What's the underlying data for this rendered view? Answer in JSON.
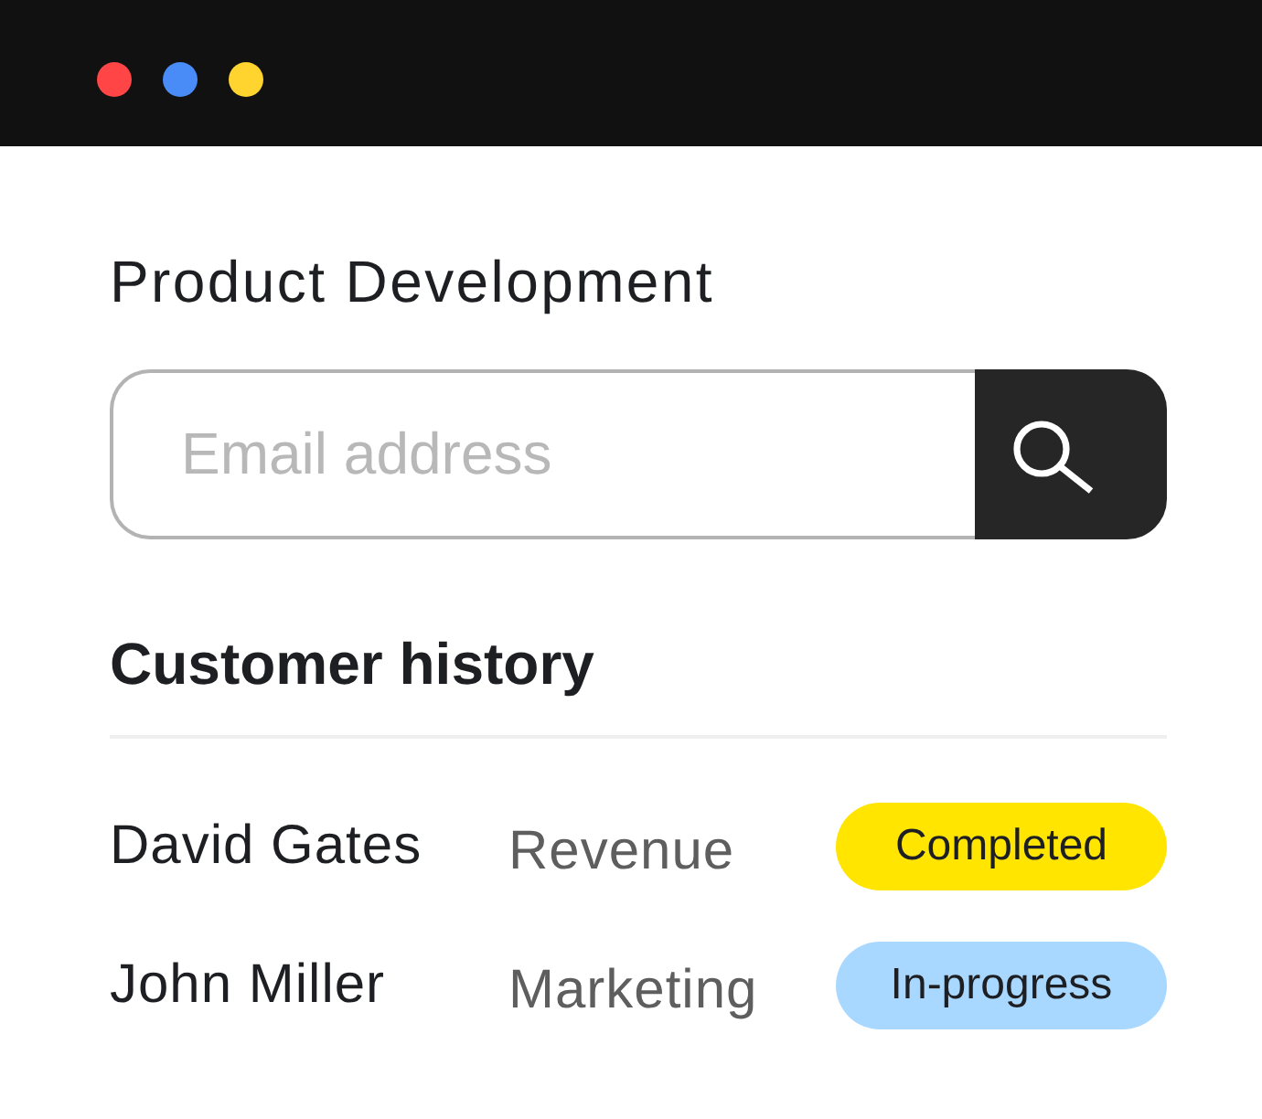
{
  "window": {
    "controls": [
      {
        "color": "#ff4545"
      },
      {
        "color": "#4a8cf7"
      },
      {
        "color": "#ffd42e"
      }
    ]
  },
  "title": "Product Development",
  "search": {
    "placeholder": "Email address"
  },
  "section": {
    "title": "Customer history"
  },
  "rows": [
    {
      "column_1": "David Gates",
      "column_2": "Revenue",
      "column_3": "Completed",
      "color": "#ffe500"
    },
    {
      "column_1": "John Miller",
      "column_2": "Marketing",
      "column_3": "In-progress",
      "color": "#a8d8ff"
    }
  ]
}
